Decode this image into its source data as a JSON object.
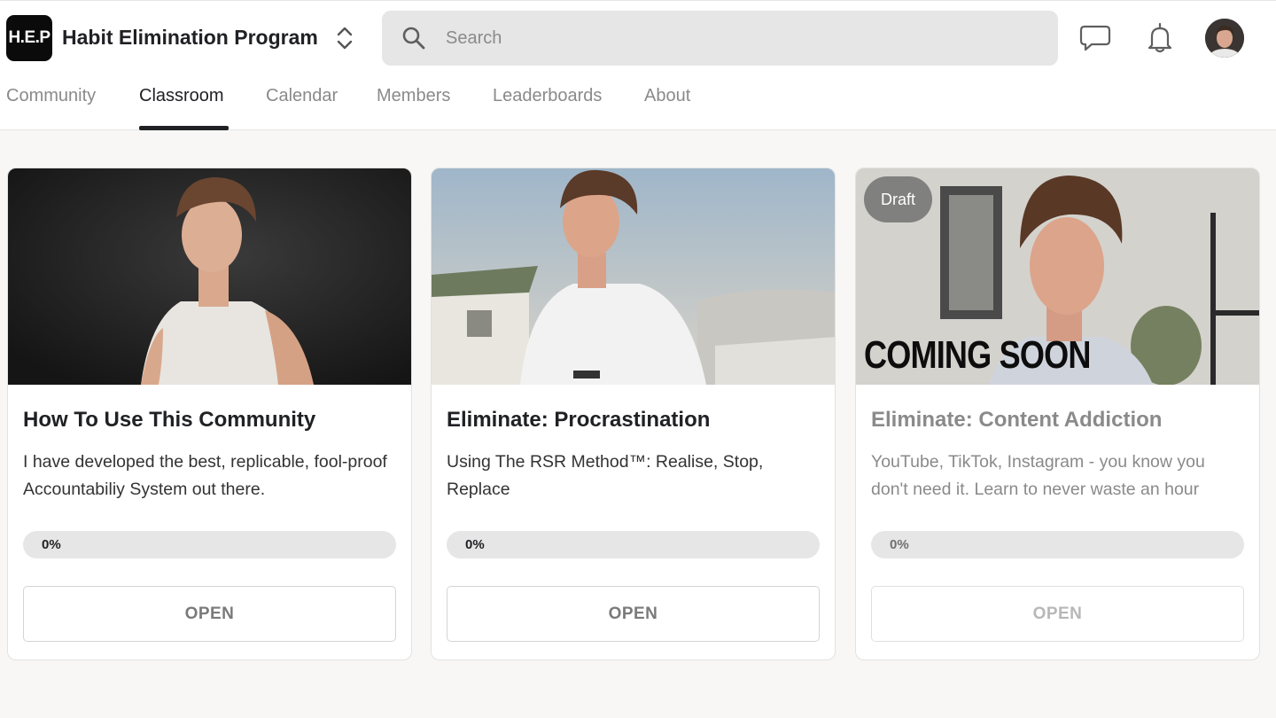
{
  "header": {
    "logo_text": "H.E.P",
    "group_name": "Habit Elimination Program",
    "search_placeholder": "Search"
  },
  "tabs": [
    {
      "label": "Community",
      "active": false
    },
    {
      "label": "Classroom",
      "active": true
    },
    {
      "label": "Calendar",
      "active": false
    },
    {
      "label": "Members",
      "active": false
    },
    {
      "label": "Leaderboards",
      "active": false
    },
    {
      "label": "About",
      "active": false
    }
  ],
  "courses": [
    {
      "title": "How To Use This Community",
      "description": "I have developed the best, replicable, fool-proof Accountabiliy System out there.",
      "progress_label": "0%",
      "progress": 0,
      "button": "OPEN",
      "draft": false
    },
    {
      "title": "Eliminate: Procrastination",
      "description": "Using The RSR Method™: Realise, Stop, Replace",
      "progress_label": "0%",
      "progress": 0,
      "button": "OPEN",
      "draft": false,
      "shirt_logo": "BOSS"
    },
    {
      "title": "Eliminate: Content Addiction",
      "description": "YouTube, TikTok, Instagram - you know you don't need it. Learn to never waste an hour",
      "progress_label": "0%",
      "progress": 0,
      "button": "OPEN",
      "draft": true,
      "badge": "Draft",
      "image_overlay": "COMING SOON"
    }
  ],
  "colors": {
    "accent": "#202124",
    "background": "#f8f7f5",
    "search_bg": "#e6e6e6",
    "progress_track": "#e6e6e6"
  }
}
